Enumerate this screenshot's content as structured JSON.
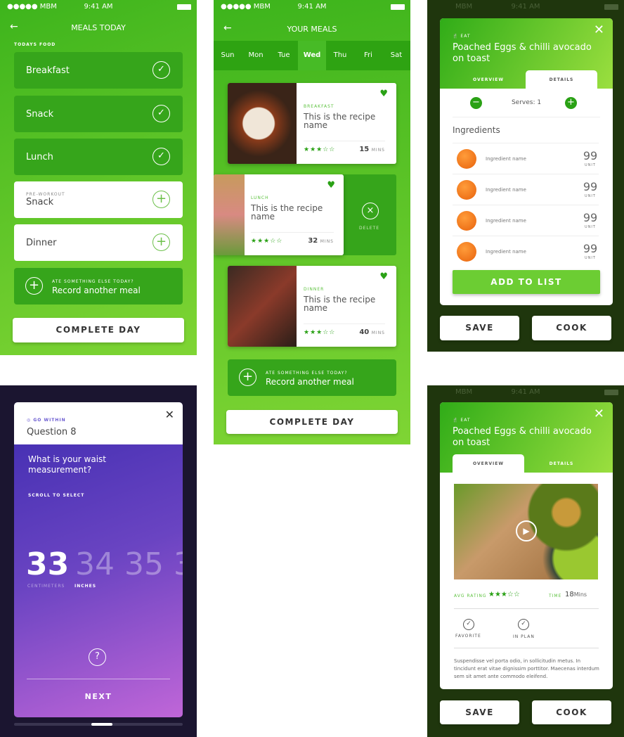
{
  "status": {
    "carrier": "●●●●● MBM",
    "time": "9:41 AM",
    "carrier_dim": "MBM"
  },
  "meals_today": {
    "title": "MEALS TODAY",
    "section": "TODAYS FOOD",
    "items": [
      {
        "label": "Breakfast",
        "done": true
      },
      {
        "label": "Snack",
        "done": true
      },
      {
        "label": "Lunch",
        "done": true
      },
      {
        "sub": "PRE-WORKOUT",
        "label": "Snack",
        "done": false
      },
      {
        "label": "Dinner",
        "done": false
      }
    ],
    "record": {
      "sub": "ATE SOMETHING ELSE TODAY?",
      "label": "Record another meal"
    },
    "complete": "COMPLETE DAY"
  },
  "your_meals": {
    "title": "YOUR MEALS",
    "days": [
      "Sun",
      "Mon",
      "Tue",
      "Wed",
      "Thu",
      "Fri",
      "Sat"
    ],
    "selected_day": "Wed",
    "cards": [
      {
        "kind": "BREAKFAST",
        "name": "This is the recipe name",
        "rating": 3,
        "mins": "15",
        "unit": "MINS"
      },
      {
        "kind": "LUNCH",
        "name": "This is the recipe name",
        "rating": 3,
        "mins": "32",
        "unit": "MINS"
      },
      {
        "kind": "DINNER",
        "name": "This is the recipe name",
        "rating": 3,
        "mins": "40",
        "unit": "MINS"
      }
    ],
    "delete": "DELETE",
    "record": {
      "sub": "ATE SOMETHING ELSE TODAY?",
      "label": "Record another meal"
    },
    "complete": "COMPLETE DAY"
  },
  "recipe": {
    "eat": "EAT",
    "title": "Poached Eggs & chilli avocado on toast",
    "tabs": [
      "OVERVIEW",
      "DETAILS"
    ],
    "serves": "Serves: 1",
    "ingredients_title": "Ingredients",
    "ingredients": [
      {
        "name": "Ingredient name",
        "qty": "99",
        "unit": "UNIT"
      },
      {
        "name": "Ingredient name",
        "qty": "99",
        "unit": "UNIT"
      },
      {
        "name": "Ingredient name",
        "qty": "99",
        "unit": "UNIT"
      },
      {
        "name": "Ingredient name",
        "qty": "99",
        "unit": "UNIT"
      }
    ],
    "add_to_list": "ADD TO LIST",
    "save": "SAVE",
    "cook": "COOK",
    "avg_rating_label": "AVG RATING",
    "rating": 3,
    "time_label": "TIME",
    "time_value": "18",
    "time_unit": "Mins",
    "favorite": "FAVORITE",
    "in_plan": "IN PLAN",
    "description": "Suspendisse vel porta odio, in sollicitudin metus. In tincidunt erat vitae dignissim porttitor. Maecenas interdum sem sit amet ante commodo eleifend."
  },
  "question": {
    "brand": "GO WITHIN",
    "title": "Question 8",
    "prompt": "What is your waist measurement?",
    "hint": "SCROLL TO SELECT",
    "values": [
      "33",
      "34",
      "35",
      "3"
    ],
    "selected": "33",
    "units": [
      "CENTIMETERS",
      "INCHES"
    ],
    "selected_unit": "INCHES",
    "next": "NEXT"
  },
  "colors": {
    "green": "#3db41c",
    "dark_green": "#1f360d",
    "purple": "#5a3dc0"
  }
}
